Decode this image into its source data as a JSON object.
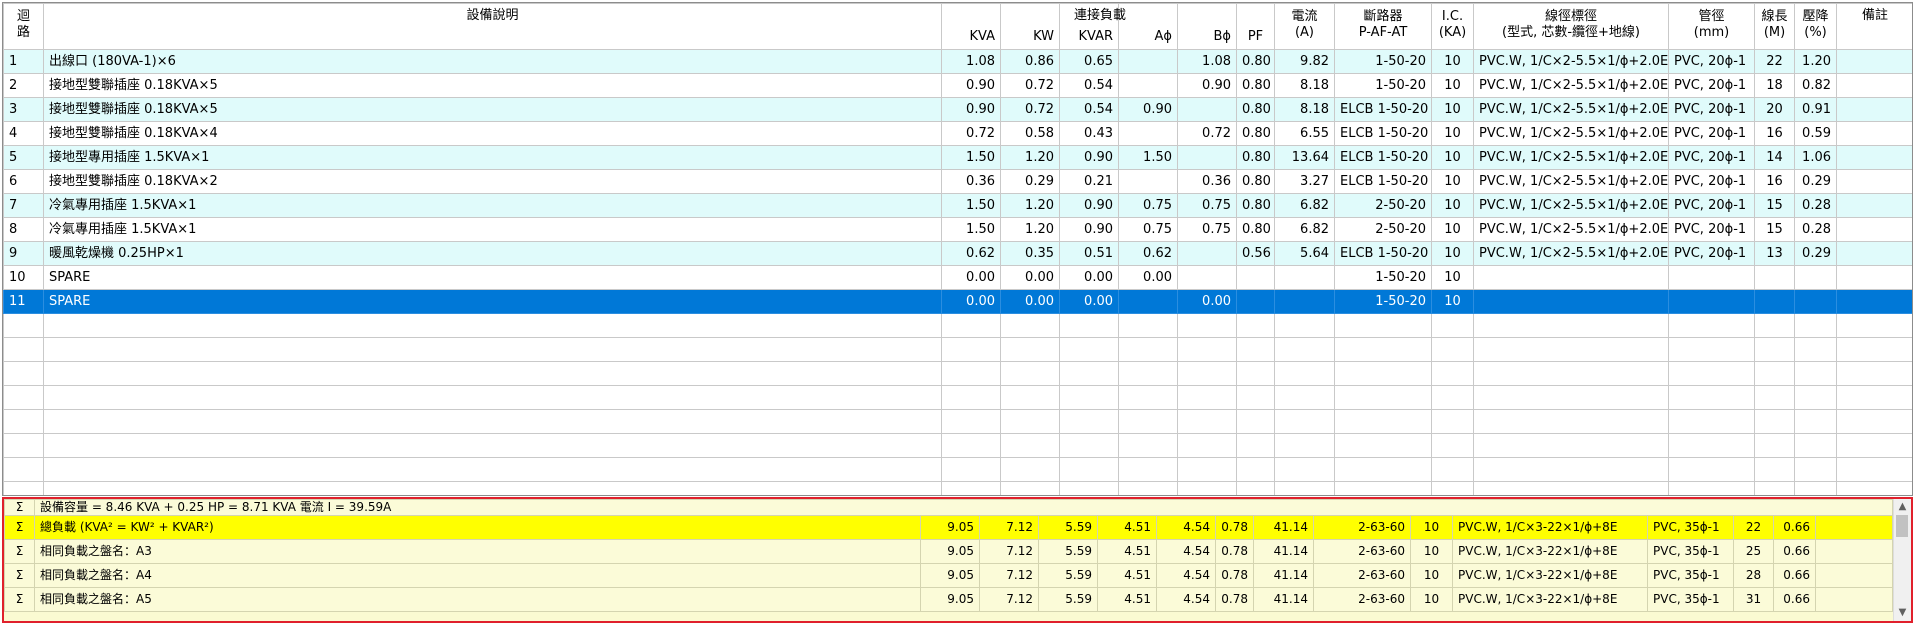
{
  "header": {
    "circuit_line1": "迴",
    "circuit_line2": "路",
    "desc": "設備說明",
    "connected_load": "連接負載",
    "kva": "KVA",
    "kw": "KW",
    "kvar": "KVAR",
    "a_phase": "Aϕ",
    "b_phase": "Bϕ",
    "pf": "PF",
    "current_line1": "電流",
    "current_line2": "(A)",
    "breaker_line1": "斷路器",
    "breaker_line2": "P-AF-AT",
    "ic_line1": "I.C.",
    "ic_line2": "(KA)",
    "wire_line1": "線徑標徑",
    "wire_line2": "(型式, 芯數-纜徑+地線)",
    "conduit_line1": "管徑",
    "conduit_line2": "(mm)",
    "length_line1": "線長",
    "length_line2": "(M)",
    "vdrop_line1": "壓降",
    "vdrop_line2": "(%)",
    "remark": "備註"
  },
  "rows": [
    {
      "no": "1",
      "desc": "出線口 (180VA-1)×6",
      "kva": "1.08",
      "kw": "0.86",
      "kvar": "0.65",
      "a": "",
      "b": "1.08",
      "pf": "0.80",
      "cur": "9.82",
      "brk": "1-50-20",
      "ic": "10",
      "wire": "PVC.W, 1/C×2-5.5×1/ϕ+2.0E",
      "conduit": "PVC, 20ϕ-1",
      "len": "22",
      "vd": "1.20",
      "rem": ""
    },
    {
      "no": "2",
      "desc": "接地型雙聯插座 0.18KVA×5",
      "kva": "0.90",
      "kw": "0.72",
      "kvar": "0.54",
      "a": "",
      "b": "0.90",
      "pf": "0.80",
      "cur": "8.18",
      "brk": "1-50-20",
      "ic": "10",
      "wire": "PVC.W, 1/C×2-5.5×1/ϕ+2.0E",
      "conduit": "PVC, 20ϕ-1",
      "len": "18",
      "vd": "0.82",
      "rem": ""
    },
    {
      "no": "3",
      "desc": "接地型雙聯插座 0.18KVA×5",
      "kva": "0.90",
      "kw": "0.72",
      "kvar": "0.54",
      "a": "0.90",
      "b": "",
      "pf": "0.80",
      "cur": "8.18",
      "brk": "ELCB 1-50-20",
      "ic": "10",
      "wire": "PVC.W, 1/C×2-5.5×1/ϕ+2.0E",
      "conduit": "PVC, 20ϕ-1",
      "len": "20",
      "vd": "0.91",
      "rem": ""
    },
    {
      "no": "4",
      "desc": "接地型雙聯插座 0.18KVA×4",
      "kva": "0.72",
      "kw": "0.58",
      "kvar": "0.43",
      "a": "",
      "b": "0.72",
      "pf": "0.80",
      "cur": "6.55",
      "brk": "ELCB 1-50-20",
      "ic": "10",
      "wire": "PVC.W, 1/C×2-5.5×1/ϕ+2.0E",
      "conduit": "PVC, 20ϕ-1",
      "len": "16",
      "vd": "0.59",
      "rem": ""
    },
    {
      "no": "5",
      "desc": "接地型專用插座 1.5KVA×1",
      "kva": "1.50",
      "kw": "1.20",
      "kvar": "0.90",
      "a": "1.50",
      "b": "",
      "pf": "0.80",
      "cur": "13.64",
      "brk": "ELCB 1-50-20",
      "ic": "10",
      "wire": "PVC.W, 1/C×2-5.5×1/ϕ+2.0E",
      "conduit": "PVC, 20ϕ-1",
      "len": "14",
      "vd": "1.06",
      "rem": ""
    },
    {
      "no": "6",
      "desc": "接地型雙聯插座 0.18KVA×2",
      "kva": "0.36",
      "kw": "0.29",
      "kvar": "0.21",
      "a": "",
      "b": "0.36",
      "pf": "0.80",
      "cur": "3.27",
      "brk": "ELCB 1-50-20",
      "ic": "10",
      "wire": "PVC.W, 1/C×2-5.5×1/ϕ+2.0E",
      "conduit": "PVC, 20ϕ-1",
      "len": "16",
      "vd": "0.29",
      "rem": ""
    },
    {
      "no": "7",
      "desc": "冷氣專用插座 1.5KVA×1",
      "kva": "1.50",
      "kw": "1.20",
      "kvar": "0.90",
      "a": "0.75",
      "b": "0.75",
      "pf": "0.80",
      "cur": "6.82",
      "brk": "2-50-20",
      "ic": "10",
      "wire": "PVC.W, 1/C×2-5.5×1/ϕ+2.0E",
      "conduit": "PVC, 20ϕ-1",
      "len": "15",
      "vd": "0.28",
      "rem": ""
    },
    {
      "no": "8",
      "desc": "冷氣專用插座 1.5KVA×1",
      "kva": "1.50",
      "kw": "1.20",
      "kvar": "0.90",
      "a": "0.75",
      "b": "0.75",
      "pf": "0.80",
      "cur": "6.82",
      "brk": "2-50-20",
      "ic": "10",
      "wire": "PVC.W, 1/C×2-5.5×1/ϕ+2.0E",
      "conduit": "PVC, 20ϕ-1",
      "len": "15",
      "vd": "0.28",
      "rem": ""
    },
    {
      "no": "9",
      "desc": "暖風乾燥機 0.25HP×1",
      "kva": "0.62",
      "kw": "0.35",
      "kvar": "0.51",
      "a": "0.62",
      "b": "",
      "pf": "0.56",
      "cur": "5.64",
      "brk": "ELCB 1-50-20",
      "ic": "10",
      "wire": "PVC.W, 1/C×2-5.5×1/ϕ+2.0E",
      "conduit": "PVC, 20ϕ-1",
      "len": "13",
      "vd": "0.29",
      "rem": ""
    },
    {
      "no": "10",
      "desc": "SPARE",
      "kva": "0.00",
      "kw": "0.00",
      "kvar": "0.00",
      "a": "0.00",
      "b": "",
      "pf": "",
      "cur": "",
      "brk": "1-50-20",
      "ic": "10",
      "wire": "",
      "conduit": "",
      "len": "",
      "vd": "",
      "rem": ""
    },
    {
      "no": "11",
      "desc": "SPARE",
      "kva": "0.00",
      "kw": "0.00",
      "kvar": "0.00",
      "a": "",
      "b": "0.00",
      "pf": "",
      "cur": "",
      "brk": "1-50-20",
      "ic": "10",
      "wire": "",
      "conduit": "",
      "len": "",
      "vd": "",
      "rem": ""
    }
  ],
  "summary": {
    "capacity": {
      "sym": "Σ",
      "text": "設備容量 = 8.46 KVA + 0.25 HP = 8.71 KVA 電流 I = 39.59A"
    },
    "rows": [
      {
        "sym": "Σ",
        "desc": "總負載 (KVA² = KW² + KVAR²)",
        "kva": "9.05",
        "kw": "7.12",
        "kvar": "5.59",
        "a": "4.51",
        "b": "4.54",
        "pf": "0.78",
        "cur": "41.14",
        "brk": "2-63-60",
        "ic": "10",
        "wire": "PVC.W, 1/C×3-22×1/ϕ+8E",
        "conduit": "PVC, 35ϕ-1",
        "len": "22",
        "vd": "0.66",
        "rem": ""
      },
      {
        "sym": "Σ",
        "desc": "相同負載之盤名：A3",
        "kva": "9.05",
        "kw": "7.12",
        "kvar": "5.59",
        "a": "4.51",
        "b": "4.54",
        "pf": "0.78",
        "cur": "41.14",
        "brk": "2-63-60",
        "ic": "10",
        "wire": "PVC.W, 1/C×3-22×1/ϕ+8E",
        "conduit": "PVC, 35ϕ-1",
        "len": "25",
        "vd": "0.66",
        "rem": ""
      },
      {
        "sym": "Σ",
        "desc": "相同負載之盤名：A4",
        "kva": "9.05",
        "kw": "7.12",
        "kvar": "5.59",
        "a": "4.51",
        "b": "4.54",
        "pf": "0.78",
        "cur": "41.14",
        "brk": "2-63-60",
        "ic": "10",
        "wire": "PVC.W, 1/C×3-22×1/ϕ+8E",
        "conduit": "PVC, 35ϕ-1",
        "len": "28",
        "vd": "0.66",
        "rem": ""
      },
      {
        "sym": "Σ",
        "desc": "相同負載之盤名：A5",
        "kva": "9.05",
        "kw": "7.12",
        "kvar": "5.59",
        "a": "4.51",
        "b": "4.54",
        "pf": "0.78",
        "cur": "41.14",
        "brk": "2-63-60",
        "ic": "10",
        "wire": "PVC.W, 1/C×3-22×1/ϕ+8E",
        "conduit": "PVC, 35ϕ-1",
        "len": "31",
        "vd": "0.66",
        "rem": ""
      }
    ]
  },
  "colors": {
    "selected": "#0078d7",
    "alt_row": "#e0fbfb",
    "highlight": "#ffff00",
    "summary_bg": "#fbfbd8",
    "summary_border": "#e0202c"
  },
  "icons": {
    "scroll_up": "chevron-up-icon",
    "scroll_down": "chevron-down-icon"
  }
}
